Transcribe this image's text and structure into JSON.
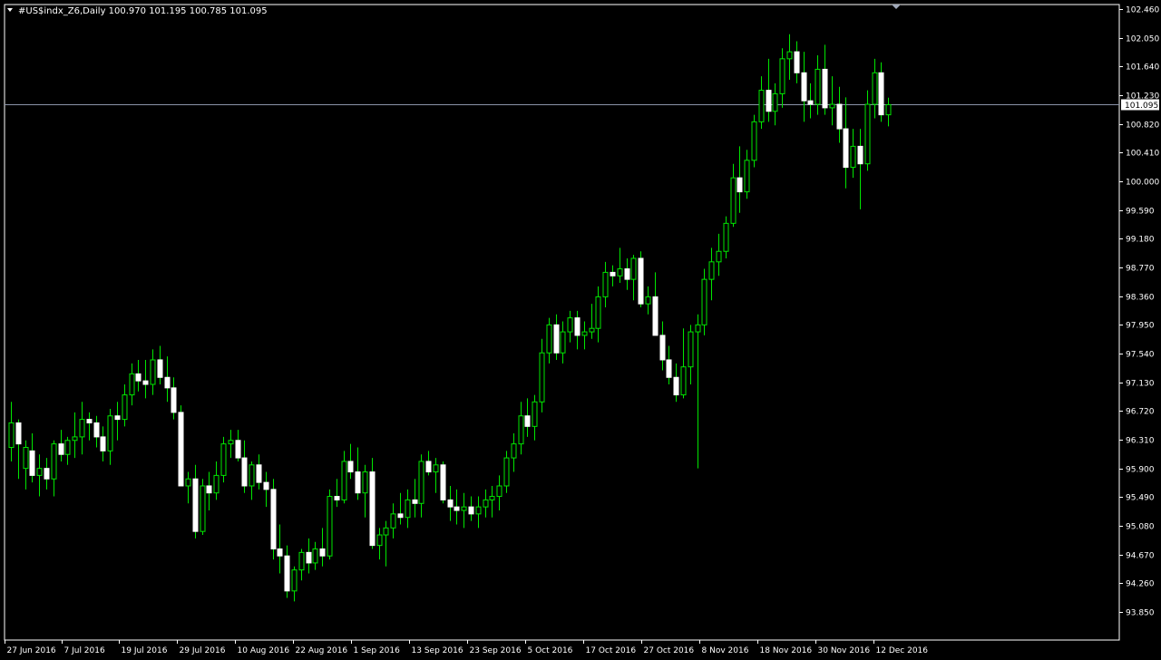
{
  "header": {
    "symbol_line": "#US$indx_Z6,Daily  100.970 101.195 100.785 101.095"
  },
  "chart_data": {
    "type": "candlestick",
    "title": "#US$indx_Z6,Daily",
    "current_price": "101.095",
    "ylim": [
      93.85,
      102.46
    ],
    "y_ticks": [
      "102.460",
      "102.050",
      "101.640",
      "101.230",
      "100.820",
      "100.410",
      "100.000",
      "99.590",
      "99.180",
      "98.770",
      "98.360",
      "97.950",
      "97.540",
      "97.130",
      "96.720",
      "96.310",
      "95.900",
      "95.490",
      "95.080",
      "94.670",
      "94.260",
      "93.850"
    ],
    "x_ticks": [
      "27 Jun 2016",
      "7 Jul 2016",
      "19 Jul 2016",
      "29 Jul 2016",
      "10 Aug 2016",
      "22 Aug 2016",
      "1 Sep 2016",
      "13 Sep 2016",
      "23 Sep 2016",
      "5 Oct 2016",
      "17 Oct 2016",
      "27 Oct 2016",
      "8 Nov 2016",
      "18 Nov 2016",
      "30 Nov 2016",
      "12 Dec 2016"
    ],
    "candles": [
      [
        96.2,
        96.85,
        96.0,
        96.55
      ],
      [
        96.55,
        96.6,
        95.75,
        96.25
      ],
      [
        95.9,
        96.3,
        95.6,
        96.2
      ],
      [
        96.15,
        96.4,
        95.7,
        95.8
      ],
      [
        95.8,
        96.1,
        95.5,
        95.9
      ],
      [
        95.9,
        96.05,
        95.6,
        95.75
      ],
      [
        95.75,
        96.3,
        95.5,
        96.25
      ],
      [
        96.25,
        96.45,
        96.0,
        96.1
      ],
      [
        96.1,
        96.35,
        95.95,
        96.3
      ],
      [
        96.3,
        96.7,
        96.05,
        96.35
      ],
      [
        96.35,
        96.85,
        96.1,
        96.6
      ],
      [
        96.6,
        96.7,
        96.3,
        96.55
      ],
      [
        96.55,
        96.65,
        96.2,
        96.35
      ],
      [
        96.35,
        96.5,
        96.0,
        96.15
      ],
      [
        96.15,
        96.75,
        95.95,
        96.65
      ],
      [
        96.65,
        96.85,
        96.3,
        96.6
      ],
      [
        96.6,
        97.1,
        96.5,
        96.95
      ],
      [
        96.95,
        97.4,
        96.8,
        97.25
      ],
      [
        97.25,
        97.45,
        97.0,
        97.15
      ],
      [
        97.15,
        97.45,
        96.9,
        97.1
      ],
      [
        97.1,
        97.6,
        96.95,
        97.45
      ],
      [
        97.45,
        97.65,
        97.1,
        97.2
      ],
      [
        97.2,
        97.5,
        96.85,
        97.05
      ],
      [
        97.05,
        97.2,
        96.6,
        96.7
      ],
      [
        96.7,
        96.8,
        95.8,
        95.65
      ],
      [
        95.65,
        95.85,
        95.4,
        95.75
      ],
      [
        95.75,
        95.95,
        94.9,
        95.0
      ],
      [
        95.0,
        95.75,
        94.95,
        95.65
      ],
      [
        95.65,
        95.85,
        95.3,
        95.55
      ],
      [
        95.55,
        96.0,
        95.45,
        95.8
      ],
      [
        95.8,
        96.35,
        95.7,
        96.25
      ],
      [
        96.25,
        96.45,
        96.05,
        96.3
      ],
      [
        96.3,
        96.45,
        96.0,
        96.05
      ],
      [
        96.05,
        96.3,
        95.55,
        95.65
      ],
      [
        95.65,
        96.0,
        95.45,
        95.95
      ],
      [
        95.95,
        96.1,
        95.6,
        95.7
      ],
      [
        95.7,
        95.85,
        95.35,
        95.6
      ],
      [
        95.6,
        95.75,
        94.6,
        94.75
      ],
      [
        94.75,
        95.1,
        94.4,
        94.65
      ],
      [
        94.65,
        94.8,
        94.05,
        94.15
      ],
      [
        94.15,
        94.5,
        94.0,
        94.45
      ],
      [
        94.45,
        94.75,
        94.3,
        94.7
      ],
      [
        94.7,
        94.9,
        94.4,
        94.55
      ],
      [
        94.55,
        94.85,
        94.45,
        94.75
      ],
      [
        94.75,
        95.05,
        94.5,
        94.65
      ],
      [
        94.65,
        95.6,
        94.6,
        95.5
      ],
      [
        95.5,
        95.75,
        95.35,
        95.45
      ],
      [
        95.45,
        96.15,
        95.4,
        96.0
      ],
      [
        96.0,
        96.25,
        95.75,
        95.85
      ],
      [
        95.85,
        96.2,
        95.45,
        95.55
      ],
      [
        95.55,
        95.95,
        95.2,
        95.85
      ],
      [
        95.85,
        96.05,
        94.75,
        94.8
      ],
      [
        94.8,
        95.05,
        94.6,
        94.95
      ],
      [
        94.95,
        95.15,
        94.5,
        95.05
      ],
      [
        95.05,
        95.4,
        94.9,
        95.25
      ],
      [
        95.25,
        95.55,
        95.1,
        95.2
      ],
      [
        95.2,
        95.6,
        95.05,
        95.45
      ],
      [
        95.45,
        95.75,
        95.2,
        95.4
      ],
      [
        95.4,
        96.1,
        95.2,
        96.0
      ],
      [
        96.0,
        96.15,
        95.8,
        95.85
      ],
      [
        95.85,
        96.05,
        95.55,
        95.95
      ],
      [
        95.95,
        96.0,
        95.4,
        95.45
      ],
      [
        95.45,
        95.65,
        95.15,
        95.35
      ],
      [
        95.35,
        95.6,
        95.1,
        95.3
      ],
      [
        95.3,
        95.55,
        95.05,
        95.35
      ],
      [
        95.35,
        95.5,
        95.15,
        95.25
      ],
      [
        95.25,
        95.5,
        95.05,
        95.35
      ],
      [
        95.35,
        95.6,
        95.2,
        95.45
      ],
      [
        95.45,
        95.65,
        95.2,
        95.5
      ],
      [
        95.5,
        95.8,
        95.3,
        95.65
      ],
      [
        95.65,
        96.15,
        95.55,
        96.05
      ],
      [
        96.05,
        96.4,
        95.85,
        96.25
      ],
      [
        96.25,
        96.85,
        96.1,
        96.65
      ],
      [
        96.65,
        96.9,
        96.35,
        96.5
      ],
      [
        96.5,
        96.95,
        96.3,
        96.85
      ],
      [
        96.85,
        97.75,
        96.7,
        97.55
      ],
      [
        97.55,
        98.05,
        97.4,
        97.95
      ],
      [
        97.95,
        98.1,
        97.45,
        97.55
      ],
      [
        97.55,
        98.0,
        97.4,
        97.85
      ],
      [
        97.85,
        98.15,
        97.7,
        98.05
      ],
      [
        98.05,
        98.15,
        97.6,
        97.8
      ],
      [
        97.8,
        98.0,
        97.6,
        97.85
      ],
      [
        97.85,
        98.25,
        97.75,
        97.9
      ],
      [
        97.9,
        98.5,
        97.7,
        98.35
      ],
      [
        98.35,
        98.85,
        98.2,
        98.7
      ],
      [
        98.7,
        98.8,
        98.5,
        98.65
      ],
      [
        98.65,
        99.05,
        98.55,
        98.75
      ],
      [
        98.75,
        98.9,
        98.45,
        98.6
      ],
      [
        98.6,
        98.95,
        98.3,
        98.9
      ],
      [
        98.9,
        99.0,
        98.2,
        98.25
      ],
      [
        98.25,
        98.5,
        98.1,
        98.35
      ],
      [
        98.35,
        98.7,
        97.85,
        97.8
      ],
      [
        97.8,
        98.0,
        97.3,
        97.45
      ],
      [
        97.45,
        97.65,
        97.1,
        97.2
      ],
      [
        97.2,
        97.4,
        96.85,
        96.95
      ],
      [
        96.95,
        97.9,
        96.9,
        97.35
      ],
      [
        97.35,
        97.95,
        97.1,
        97.85
      ],
      [
        97.85,
        98.1,
        95.9,
        97.95
      ],
      [
        97.95,
        98.75,
        97.8,
        98.6
      ],
      [
        98.6,
        99.05,
        98.3,
        98.85
      ],
      [
        98.85,
        99.25,
        98.65,
        99.0
      ],
      [
        99.0,
        99.5,
        98.9,
        99.4
      ],
      [
        99.4,
        100.25,
        99.35,
        100.05
      ],
      [
        100.05,
        100.5,
        99.55,
        99.85
      ],
      [
        99.85,
        100.45,
        99.75,
        100.3
      ],
      [
        100.3,
        100.95,
        100.2,
        100.85
      ],
      [
        100.85,
        101.5,
        100.75,
        101.3
      ],
      [
        101.3,
        101.75,
        100.85,
        101.0
      ],
      [
        101.0,
        101.4,
        100.8,
        101.25
      ],
      [
        101.25,
        101.9,
        101.05,
        101.75
      ],
      [
        101.75,
        102.1,
        101.45,
        101.85
      ],
      [
        101.85,
        102.0,
        101.4,
        101.55
      ],
      [
        101.55,
        101.85,
        100.85,
        101.15
      ],
      [
        101.15,
        101.4,
        100.9,
        101.1
      ],
      [
        101.1,
        101.8,
        100.95,
        101.6
      ],
      [
        101.6,
        101.95,
        100.95,
        101.05
      ],
      [
        101.05,
        101.5,
        100.8,
        101.1
      ],
      [
        101.1,
        101.35,
        100.55,
        100.75
      ],
      [
        100.75,
        101.2,
        99.9,
        100.2
      ],
      [
        100.2,
        100.75,
        100.05,
        100.5
      ],
      [
        100.5,
        100.75,
        99.6,
        100.25
      ],
      [
        100.25,
        101.3,
        100.15,
        101.1
      ],
      [
        101.1,
        101.75,
        100.9,
        101.55
      ],
      [
        101.55,
        101.7,
        100.85,
        100.95
      ],
      [
        100.95,
        101.195,
        100.785,
        101.095
      ]
    ]
  }
}
